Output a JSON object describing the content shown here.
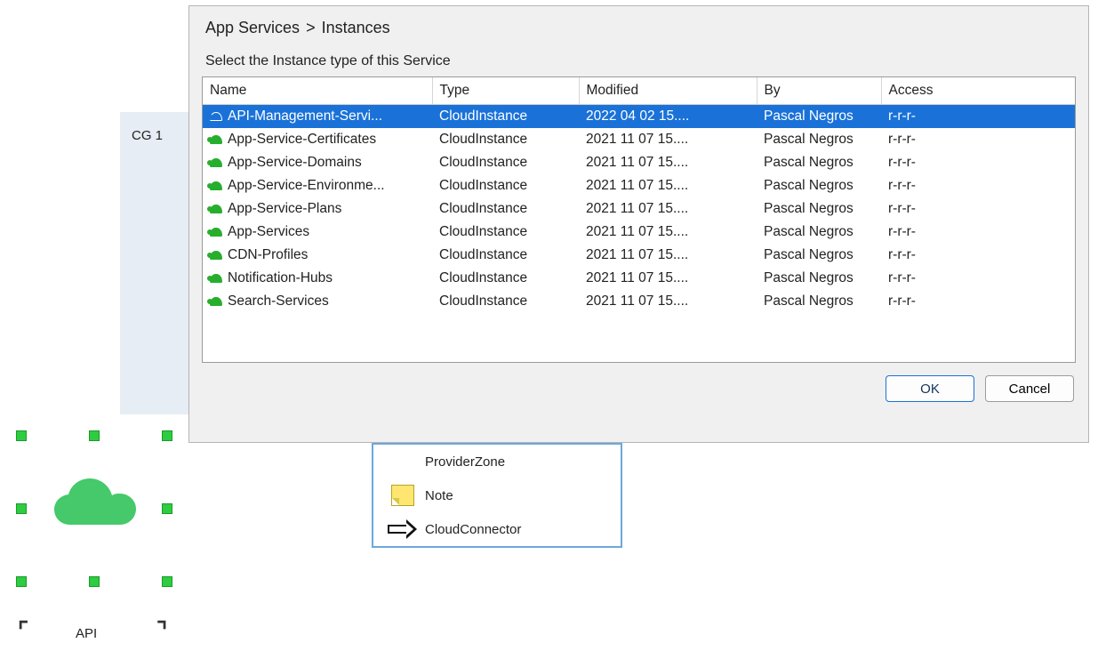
{
  "diagram": {
    "cg_label": "CG 1",
    "api_label": "API",
    "palette": {
      "provider_zone": "ProviderZone",
      "note": "Note",
      "cloud_connector": "CloudConnector"
    }
  },
  "dialog": {
    "breadcrumb": {
      "parent": "App Services",
      "sep": ">",
      "current": "Instances"
    },
    "subtitle": "Select the Instance type of this Service",
    "columns": {
      "name": "Name",
      "type": "Type",
      "modified": "Modified",
      "by": "By",
      "access": "Access"
    },
    "rows": [
      {
        "name": "API-Management-Servi...",
        "type": "CloudInstance",
        "modified": "2022 04 02 15....",
        "by": "Pascal Negros",
        "access": "r-r-r-",
        "selected": true
      },
      {
        "name": "App-Service-Certificates",
        "type": "CloudInstance",
        "modified": "2021 11 07 15....",
        "by": "Pascal Negros",
        "access": "r-r-r-"
      },
      {
        "name": "App-Service-Domains",
        "type": "CloudInstance",
        "modified": "2021 11 07 15....",
        "by": "Pascal Negros",
        "access": "r-r-r-"
      },
      {
        "name": "App-Service-Environme...",
        "type": "CloudInstance",
        "modified": "2021 11 07 15....",
        "by": "Pascal Negros",
        "access": "r-r-r-"
      },
      {
        "name": "App-Service-Plans",
        "type": "CloudInstance",
        "modified": "2021 11 07 15....",
        "by": "Pascal Negros",
        "access": "r-r-r-"
      },
      {
        "name": "App-Services",
        "type": "CloudInstance",
        "modified": "2021 11 07 15....",
        "by": "Pascal Negros",
        "access": "r-r-r-"
      },
      {
        "name": "CDN-Profiles",
        "type": "CloudInstance",
        "modified": "2021 11 07 15....",
        "by": "Pascal Negros",
        "access": "r-r-r-"
      },
      {
        "name": "Notification-Hubs",
        "type": "CloudInstance",
        "modified": "2021 11 07 15....",
        "by": "Pascal Negros",
        "access": "r-r-r-"
      },
      {
        "name": "Search-Services",
        "type": "CloudInstance",
        "modified": "2021 11 07 15....",
        "by": "Pascal Negros",
        "access": "r-r-r-"
      }
    ],
    "buttons": {
      "ok": "OK",
      "cancel": "Cancel"
    }
  }
}
